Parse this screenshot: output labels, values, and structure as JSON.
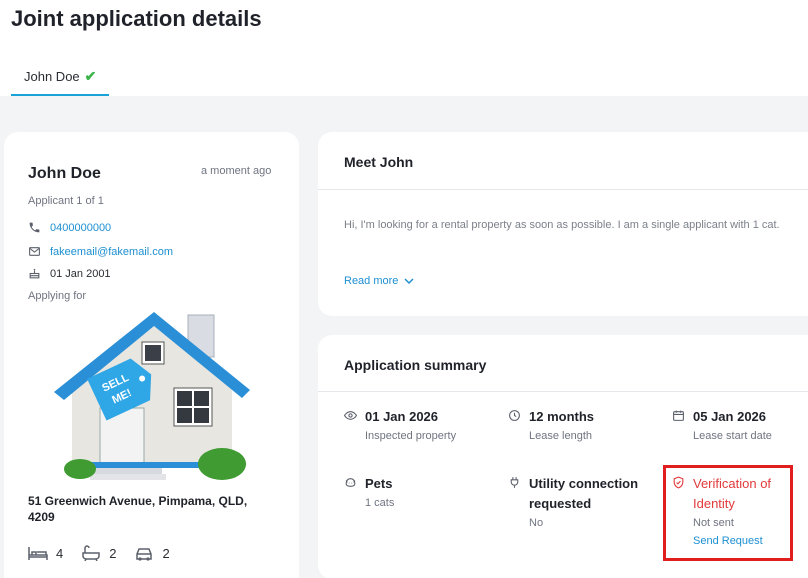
{
  "header": {
    "title": "Joint application details"
  },
  "tabs": [
    {
      "label": "John Doe",
      "verified": true
    }
  ],
  "applicant": {
    "name": "John Doe",
    "timestamp": "a moment ago",
    "applicant_count": "Applicant 1 of 1",
    "phone": "0400000000",
    "email": "fakeemail@fakemail.com",
    "dob": "01 Jan 2001",
    "applying_for_label": "Applying for",
    "address": "51 Greenwich Avenue, Pimpama, QLD, 4209",
    "property_image_text": "SELL ME!",
    "bedrooms": "4",
    "bathrooms": "2",
    "parking": "2"
  },
  "meet": {
    "title": "Meet John",
    "text": "Hi, I'm looking for a rental property as soon as possible. I am a single applicant with 1 cat.",
    "read_more": "Read more"
  },
  "summary": {
    "title": "Application summary",
    "items": [
      {
        "icon": "eye-icon",
        "value": "01 Jan 2026",
        "label": "Inspected property"
      },
      {
        "icon": "clock-icon",
        "value": "12 months",
        "label": "Lease length"
      },
      {
        "icon": "calendar-icon",
        "value": "05 Jan 2026",
        "label": "Lease start date"
      },
      {
        "icon": "pets-icon",
        "value": "Pets",
        "label": "1 cats"
      },
      {
        "icon": "plug-icon",
        "value": "Utility connection requested",
        "label": "No"
      },
      {
        "icon": "shield-icon",
        "value": "Verification of Identity",
        "label": "Not sent",
        "action": "Send Request"
      }
    ]
  },
  "colors": {
    "accent": "#19a3d6",
    "link": "#1d8fd1",
    "success": "#3bb54a",
    "alert": "#e23a3a",
    "highlight": "#e01e1e"
  }
}
